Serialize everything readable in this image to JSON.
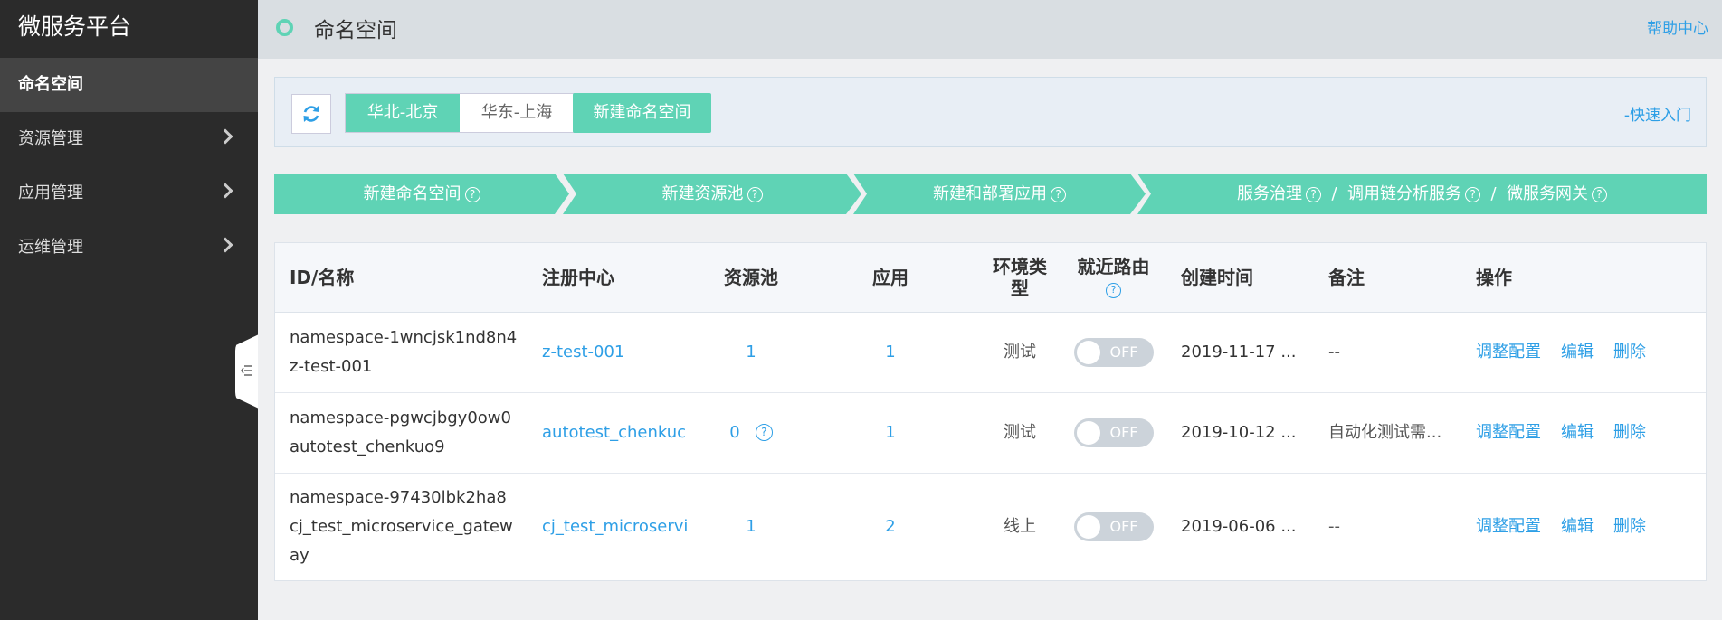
{
  "sidebar": {
    "brand": "微服务平台",
    "items": [
      {
        "label": "命名空间",
        "active": true
      },
      {
        "label": "资源管理"
      },
      {
        "label": "应用管理"
      },
      {
        "label": "运维管理"
      }
    ]
  },
  "header": {
    "title": "命名空间",
    "help": "帮助中心"
  },
  "toolbar": {
    "regions": [
      "华北-北京",
      "华东-上海"
    ],
    "active_region": "华北-北京",
    "new_namespace": "新建命名空间",
    "quick_start": "-快速入门"
  },
  "steps": [
    {
      "label": "新建命名空间"
    },
    {
      "label": "新建资源池"
    },
    {
      "label": "新建和部署应用"
    },
    {
      "label": "服务治理",
      "extra1": "调用链分析服务",
      "extra2": "微服务网关"
    }
  ],
  "table": {
    "headers": {
      "id_name": "ID/名称",
      "registry": "注册中心",
      "pool": "资源池",
      "app": "应用",
      "env_line1": "环境类",
      "env_line2": "型",
      "routing": "就近路由",
      "created": "创建时间",
      "remark": "备注",
      "ops": "操作"
    },
    "rows": [
      {
        "id": "namespace-1wncjsk1nd8n4",
        "name": "z-test-001",
        "registry": "z-test-001",
        "pool": "1",
        "app": "1",
        "env": "测试",
        "routing": "OFF",
        "created": "2019-11-17 ...",
        "remark": "--",
        "op_config": "调整配置",
        "op_edit": "编辑",
        "op_delete": "删除"
      },
      {
        "id": "namespace-pgwcjbgy0ow0",
        "name": "autotest_chenkuo9",
        "registry": "autotest_chenkuc",
        "pool": "0",
        "app": "1",
        "env": "测试",
        "routing": "OFF",
        "created": "2019-10-12 ...",
        "remark": "自动化测试需...",
        "op_config": "调整配置",
        "op_edit": "编辑",
        "op_delete": "删除"
      },
      {
        "id": "namespace-97430lbk2ha8",
        "name": "cj_test_microservice_gateway",
        "registry": "cj_test_microservi",
        "pool": "1",
        "app": "2",
        "env": "线上",
        "routing": "OFF",
        "created": "2019-06-06 ...",
        "remark": "--",
        "op_config": "调整配置",
        "op_edit": "编辑",
        "op_delete": "删除"
      }
    ]
  },
  "colors": {
    "accent": "#5fd3b5",
    "link": "#2e9fe6",
    "sidebar_bg": "#2b2b2b"
  },
  "icons": {
    "refresh": "refresh-icon",
    "help": "question-circle-icon",
    "collapse": "collapse-sidebar-icon",
    "chevron": "chevron-right-icon"
  }
}
